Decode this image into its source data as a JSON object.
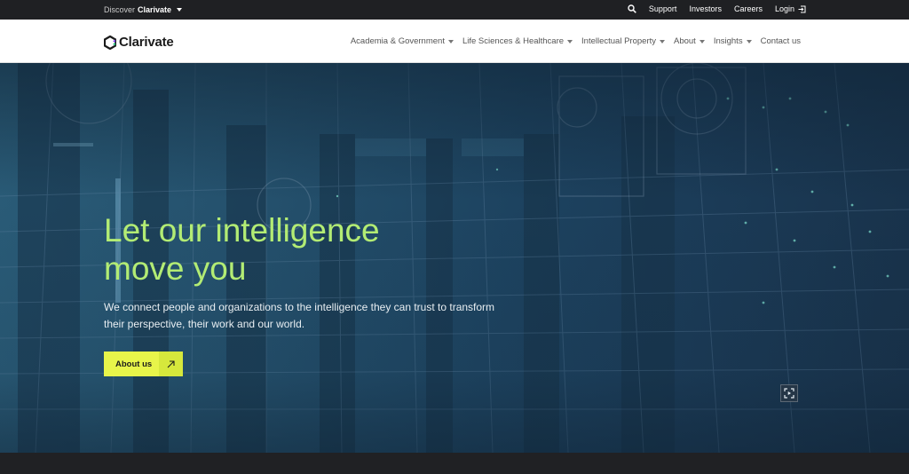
{
  "topbar": {
    "discover_prefix": "Discover",
    "discover_brand": "Clarivate",
    "links": [
      "Support",
      "Investors",
      "Careers",
      "Login"
    ],
    "icons": {
      "search": "search-icon",
      "login": "login-icon"
    }
  },
  "nav": {
    "logo_text": "Clarivate",
    "items": [
      {
        "label": "Academia & Government",
        "dropdown": true
      },
      {
        "label": "Life Sciences & Healthcare",
        "dropdown": true
      },
      {
        "label": "Intellectual Property",
        "dropdown": true
      },
      {
        "label": "About",
        "dropdown": true
      },
      {
        "label": "Insights",
        "dropdown": true
      },
      {
        "label": "Contact us",
        "dropdown": false
      }
    ]
  },
  "hero": {
    "title_line1": "Let our intelligence",
    "title_line2": "move you",
    "description": "We connect people and organizations to the intelligence they can trust to transform their perspective, their work and our world.",
    "cta_label": "About us",
    "cta_icon": "arrow-up-right-icon",
    "expand_icon": "fullscreen-icon"
  },
  "colors": {
    "title_green": "#b3ec74",
    "cta_yellow": "#e8f54a",
    "topbar_bg": "#1f2023",
    "hero_blue": "#1d4360"
  }
}
